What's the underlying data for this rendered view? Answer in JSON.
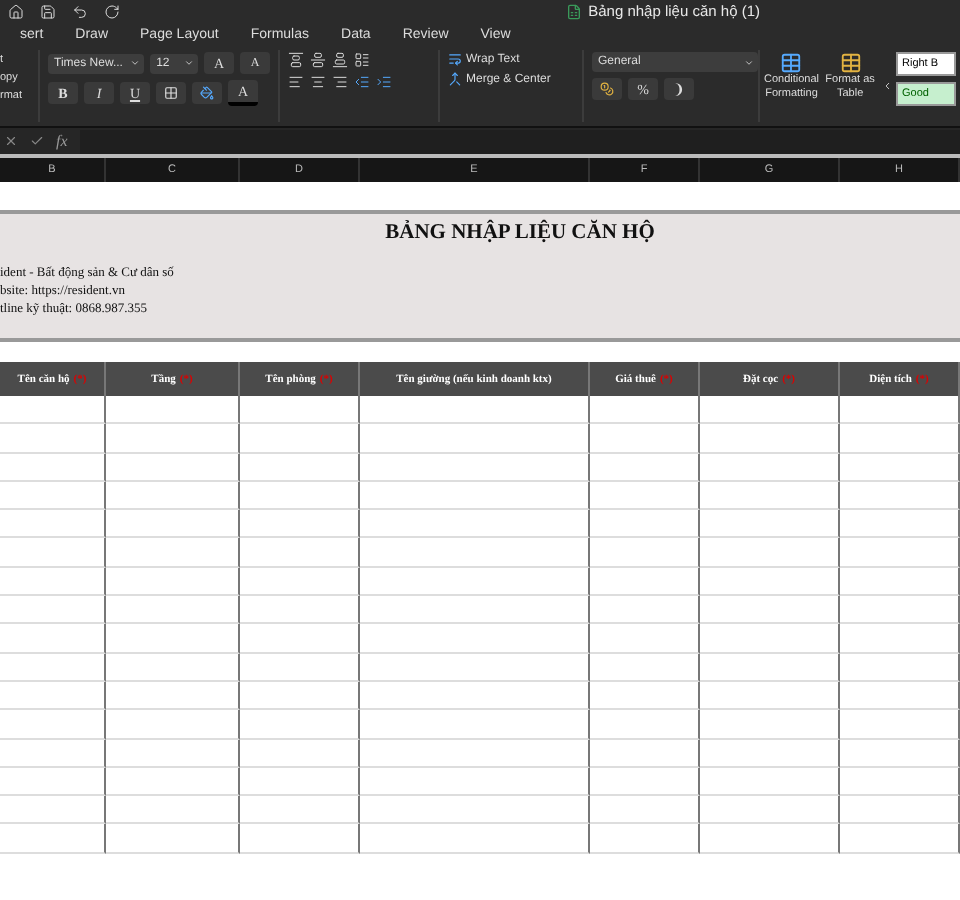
{
  "window": {
    "title": "Bảng nhập liệu căn hộ (1)"
  },
  "tabs": [
    {
      "label": "sert",
      "selected": false
    },
    {
      "label": "Draw",
      "selected": false
    },
    {
      "label": "Page Layout",
      "selected": false
    },
    {
      "label": "Formulas",
      "selected": false
    },
    {
      "label": "Data",
      "selected": false
    },
    {
      "label": "Review",
      "selected": false
    },
    {
      "label": "View",
      "selected": false
    }
  ],
  "clipboard": [
    "t",
    "opy",
    "rmat"
  ],
  "font": {
    "name": "Times New...",
    "size": "12",
    "grow": "A",
    "shrink": "A",
    "bold": "B",
    "italic": "I",
    "underline": "U",
    "font_color": "A"
  },
  "alignment": {
    "wrap_text": "Wrap Text",
    "merge": "Merge & Center"
  },
  "number": {
    "format": "General",
    "percent": "%",
    "comma": "❩"
  },
  "styles": {
    "conditional": "Conditional Formatting",
    "format_table": "Format as Table",
    "cells": [
      {
        "label": "Right B",
        "kind": "normal"
      },
      {
        "label": "Good",
        "kind": "good"
      }
    ]
  },
  "formula_bar": {
    "fx": "fx"
  },
  "column_letters": [
    "B",
    "C",
    "D",
    "E",
    "F",
    "G",
    "H"
  ],
  "banner": {
    "title": "BẢNG NHẬP LIỆU CĂN HỘ",
    "lines": [
      "ident - Bất động sản & Cư dân số",
      "bsite: https://resident.vn",
      "tline kỹ thuật: 0868.987.355"
    ]
  },
  "table": {
    "columns": [
      {
        "label": "Tên căn hộ",
        "required": "(*)"
      },
      {
        "label": "Tầng",
        "required": "(*)"
      },
      {
        "label": "Tên phòng",
        "required": "(*)"
      },
      {
        "label": "Tên giường (nếu kinh doanh ktx)"
      },
      {
        "label": "Giá thuê",
        "required": "(*)"
      },
      {
        "label": "Đặt cọc",
        "required": "(*)"
      },
      {
        "label": "Diện tích",
        "required": "(*)"
      }
    ]
  }
}
